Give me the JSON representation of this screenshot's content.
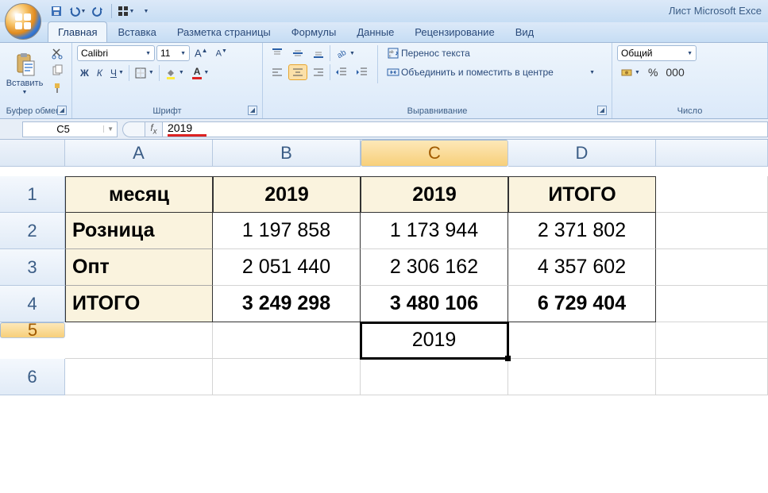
{
  "app": {
    "title": "Лист Microsoft Exce"
  },
  "qat": {
    "save": "save",
    "undo": "undo",
    "redo": "redo",
    "grid": "grid"
  },
  "tabs": [
    {
      "label": "Главная",
      "active": true
    },
    {
      "label": "Вставка"
    },
    {
      "label": "Разметка страницы"
    },
    {
      "label": "Формулы"
    },
    {
      "label": "Данные"
    },
    {
      "label": "Рецензирование"
    },
    {
      "label": "Вид"
    }
  ],
  "ribbon": {
    "clipboard": {
      "paste": "Вставить",
      "label": "Буфер обмена"
    },
    "font": {
      "name": "Calibri",
      "size": "11",
      "label": "Шрифт"
    },
    "align": {
      "wrap": "Перенос текста",
      "merge": "Объединить и поместить в центре",
      "label": "Выравнивание"
    },
    "number": {
      "format": "Общий",
      "label": "Число",
      "percent": "%",
      "comma": ","
    }
  },
  "formula_bar": {
    "namebox": "C5",
    "value": "2019"
  },
  "sheet": {
    "cols": [
      "A",
      "B",
      "C",
      "D",
      ""
    ],
    "rows": [
      "1",
      "2",
      "3",
      "4",
      "5",
      "6"
    ],
    "active": {
      "row": 5,
      "col": "C"
    },
    "data": {
      "A1": "месяц",
      "B1": "2019",
      "C1": "2019",
      "D1": "ИТОГО",
      "A2": "Розница",
      "B2": "1 197 858",
      "C2": "1 173 944",
      "D2": "2 371 802",
      "A3": "Опт",
      "B3": "2 051 440",
      "C3": "2 306 162",
      "D3": "4 357 602",
      "A4": "ИТОГО",
      "B4": "3 249 298",
      "C4": "3 480 106",
      "D4": "6 729 404",
      "C5": "2019"
    }
  },
  "chart_data": {
    "type": "table",
    "columns": [
      "месяц",
      "2019",
      "2019",
      "ИТОГО"
    ],
    "rows": [
      {
        "label": "Розница",
        "values": [
          1197858,
          1173944,
          2371802
        ]
      },
      {
        "label": "Опт",
        "values": [
          2051440,
          2306162,
          4357602
        ]
      },
      {
        "label": "ИТОГО",
        "values": [
          3249298,
          3480106,
          6729404
        ]
      }
    ]
  }
}
